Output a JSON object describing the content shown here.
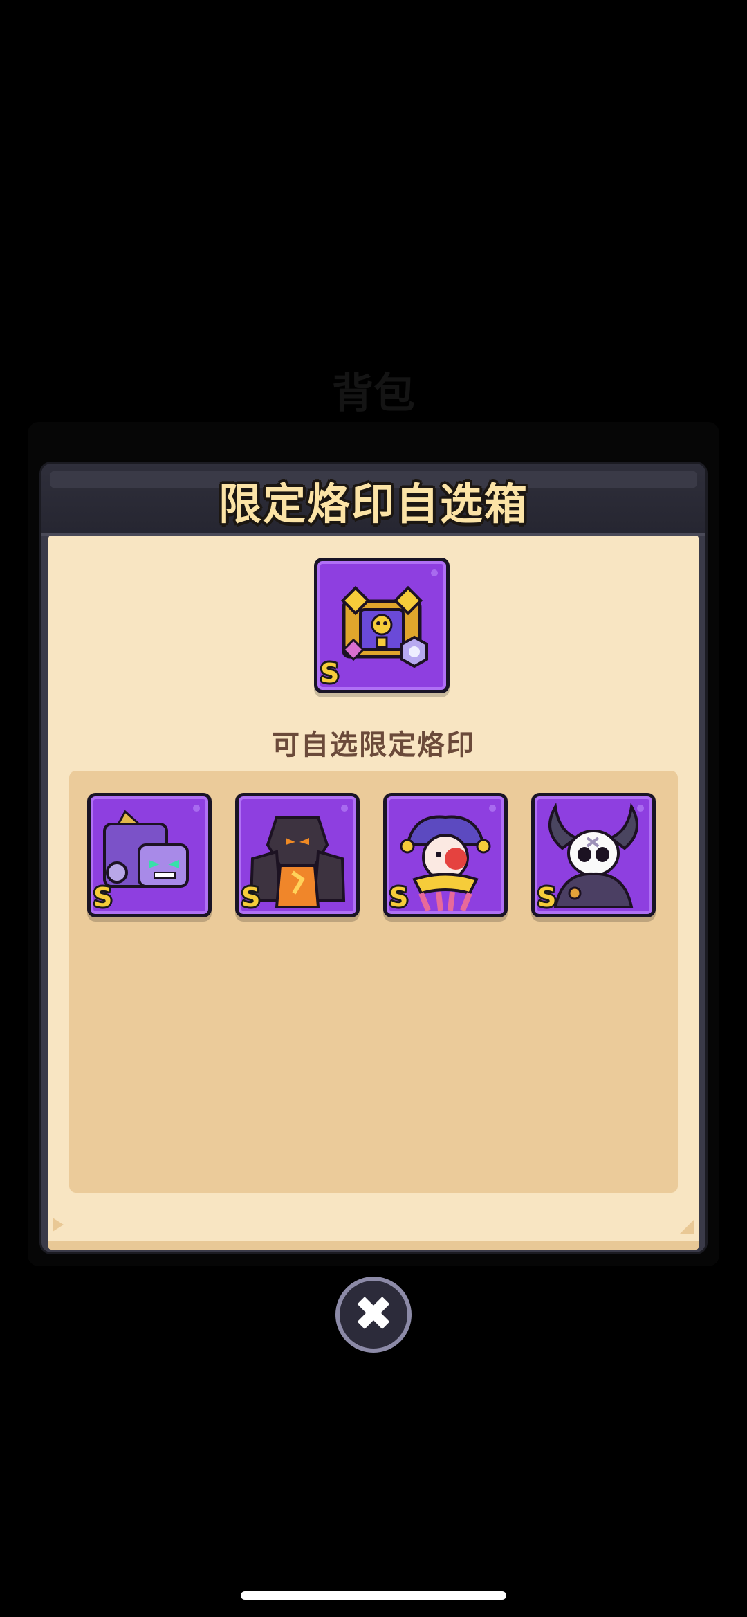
{
  "background": {
    "title": "背包"
  },
  "modal": {
    "title": "限定烙印自选箱",
    "featured_item": {
      "rank": "S",
      "icon": "skull-chest-icon"
    },
    "subtitle": "可自选限定烙印",
    "options": [
      {
        "rank": "S",
        "icon": "purple-robot-icon"
      },
      {
        "rank": "S",
        "icon": "lava-golem-icon"
      },
      {
        "rank": "S",
        "icon": "jester-clown-icon"
      },
      {
        "rank": "S",
        "icon": "horned-skull-icon"
      }
    ]
  },
  "close_button": {
    "icon": "close-icon",
    "symbol": "✖"
  },
  "colors": {
    "card_purple": "#8e3fe0",
    "title_gold": "#fbe3a6",
    "rank_gold": "#f6cc3a",
    "body_cream": "#f8e5c2",
    "inner_tan": "#ebcb9a"
  }
}
